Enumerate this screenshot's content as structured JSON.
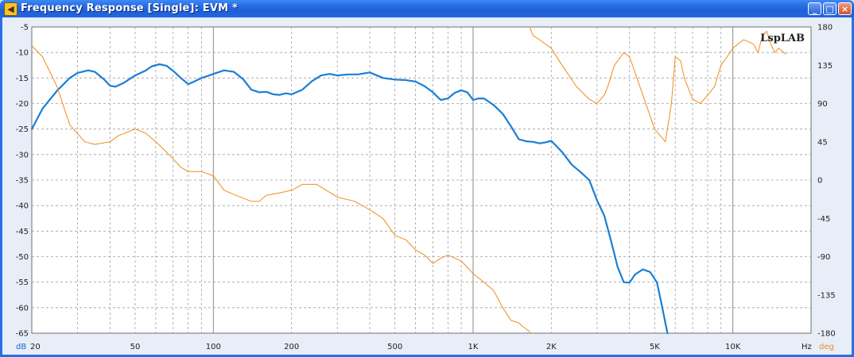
{
  "window": {
    "title": "Frequency Response [Single]: EVM *",
    "minimize_icon": "minimize-icon",
    "maximize_icon": "maximize-icon",
    "close_icon": "close-icon"
  },
  "chart_data": {
    "type": "line",
    "title": "",
    "watermark": "LspLAB",
    "x_scale": "log",
    "xlim": [
      20,
      20000
    ],
    "xticks": [
      {
        "value": 20,
        "label": "20"
      },
      {
        "value": 50,
        "label": "50"
      },
      {
        "value": 100,
        "label": "100"
      },
      {
        "value": 200,
        "label": "200"
      },
      {
        "value": 500,
        "label": "500"
      },
      {
        "value": 1000,
        "label": "1K"
      },
      {
        "value": 2000,
        "label": "2K"
      },
      {
        "value": 5000,
        "label": "5K"
      },
      {
        "value": 10000,
        "label": "10K"
      }
    ],
    "x_unit_label": "Hz",
    "y_left": {
      "unit_label": "dB",
      "lim": [
        -65,
        -5
      ],
      "ticks": [
        -5,
        -10,
        -15,
        -20,
        -25,
        -30,
        -35,
        -40,
        -45,
        -50,
        -55,
        -60,
        -65
      ]
    },
    "y_right": {
      "unit_label": "deg",
      "lim": [
        -180,
        180
      ],
      "ticks": [
        180,
        135,
        90,
        45,
        0,
        -45,
        -90,
        -135,
        -180
      ]
    },
    "grid": true,
    "colors": {
      "magnitude": "#1a7fd6",
      "phase": "#f08c1a",
      "plot_bg": "#ffffff",
      "grid_major": "#8a8a8a",
      "grid_minor": "#a0a0a0",
      "axis_label": "#1e64c8"
    },
    "series": [
      {
        "axis": "left",
        "x": [
          20,
          22,
          25,
          28,
          30,
          33,
          35,
          38,
          40,
          42,
          45,
          50,
          55,
          58,
          62,
          66,
          70,
          75,
          80,
          85,
          90,
          95,
          100,
          110,
          120,
          130,
          140,
          150,
          160,
          170,
          180,
          190,
          200,
          220,
          240,
          260,
          280,
          300,
          330,
          360,
          400,
          450,
          500,
          550,
          600,
          650,
          700,
          750,
          800,
          850,
          900,
          950,
          1000,
          1050,
          1100,
          1200,
          1300,
          1400,
          1500,
          1600,
          1700,
          1800,
          1900,
          2000,
          2200,
          2400,
          2600,
          2800,
          3000,
          3200,
          3400,
          3600,
          3800,
          4000,
          4200,
          4500,
          4800,
          5100,
          5300,
          5500,
          5600
        ],
        "values": [
          -25,
          -21,
          -17.5,
          -15,
          -14,
          -13.5,
          -13.8,
          -15.3,
          -16.5,
          -16.7,
          -16,
          -14.5,
          -13.5,
          -12.7,
          -12.3,
          -12.6,
          -13.6,
          -15,
          -16.2,
          -15.6,
          -15,
          -14.6,
          -14.2,
          -13.5,
          -13.8,
          -15.2,
          -17.3,
          -17.8,
          -17.7,
          -18.2,
          -18.3,
          -18.0,
          -18.2,
          -17.3,
          -15.6,
          -14.5,
          -14.2,
          -14.5,
          -14.3,
          -14.3,
          -13.9,
          -15.0,
          -15.3,
          -15.4,
          -15.7,
          -16.6,
          -17.8,
          -19.3,
          -19.0,
          -17.9,
          -17.4,
          -17.8,
          -19.3,
          -19.0,
          -19.0,
          -20.3,
          -22.0,
          -24.5,
          -27.0,
          -27.4,
          -27.5,
          -27.8,
          -27.6,
          -27.3,
          -29.5,
          -32.0,
          -33.5,
          -35.0,
          -39.0,
          -42.0,
          -47.0,
          -52.0,
          -55.0,
          -55.1,
          -53.5,
          -52.5,
          -53.0,
          -55.0,
          -59.0,
          -63.0,
          -65.0
        ]
      },
      {
        "axis": "right",
        "x": [
          20,
          22,
          25,
          28,
          32,
          35,
          40,
          43,
          50,
          55,
          60,
          65,
          70,
          75,
          80,
          90,
          100,
          110,
          120,
          140,
          150,
          160,
          180,
          200,
          220,
          250,
          300,
          350,
          400,
          450,
          500,
          550,
          600,
          650,
          700,
          750,
          800,
          900,
          1000,
          1100,
          1200,
          1300,
          1400,
          1500,
          1550,
          1600,
          1650,
          1660,
          1700,
          1800,
          2000,
          2200,
          2500,
          2800,
          3000,
          3200,
          3300,
          3500,
          3800,
          4000,
          4500,
          5000,
          5500,
          5800,
          6000,
          6300,
          6500,
          6800,
          7000,
          7500,
          8000,
          8500,
          9000,
          9500,
          10000,
          11000,
          12000,
          12500,
          13000,
          13500,
          14000,
          14500,
          15000,
          16000
        ],
        "values": [
          158,
          145,
          110,
          65,
          45,
          42,
          45,
          52,
          60,
          55,
          45,
          35,
          25,
          15,
          10,
          10,
          5,
          -12,
          -17,
          -25,
          -25,
          -18,
          -15,
          -12,
          -5,
          -5,
          -20,
          -25,
          -35,
          -45,
          -65,
          -70,
          -82,
          -88,
          -98,
          -92,
          -88,
          -95,
          -110,
          -120,
          -130,
          -150,
          -165,
          -168,
          -172,
          -175,
          -178,
          178,
          170,
          165,
          155,
          135,
          110,
          95,
          90,
          100,
          110,
          135,
          150,
          145,
          100,
          60,
          45,
          90,
          145,
          140,
          120,
          105,
          95,
          90,
          100,
          110,
          135,
          145,
          155,
          165,
          160,
          150,
          170,
          175,
          160,
          150,
          155,
          148
        ]
      }
    ]
  }
}
